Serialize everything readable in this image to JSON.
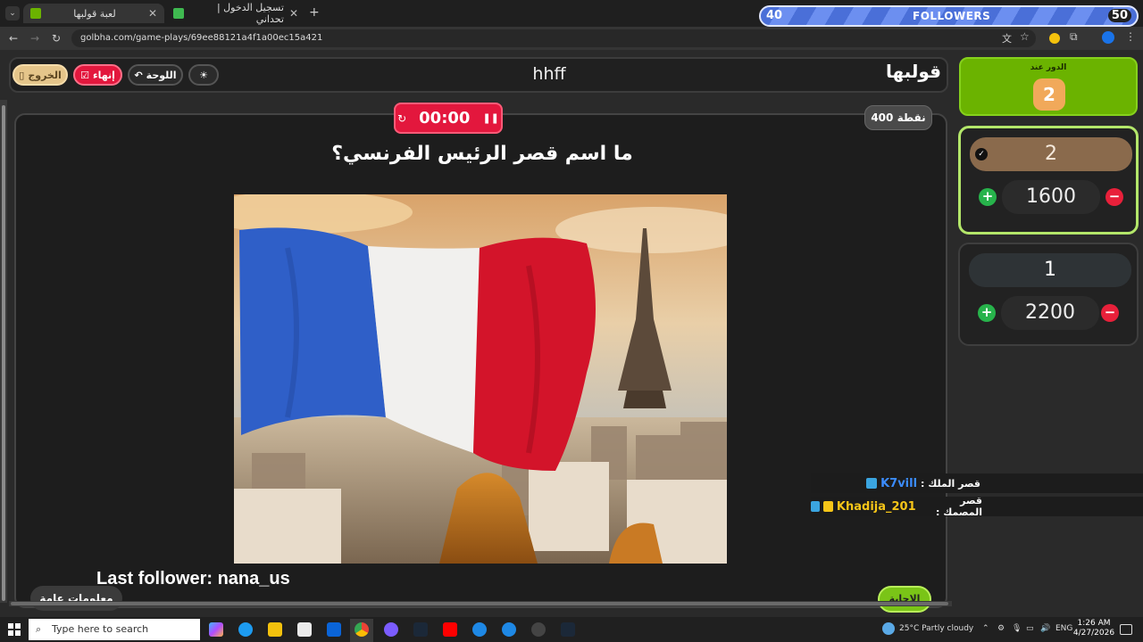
{
  "browser": {
    "tabs": [
      {
        "title": "لعبة قولبها"
      },
      {
        "title": "تسجيل الدخول | تحداني"
      }
    ],
    "url": "golbha.com/game-plays/69ee88121a4f1a00ec15a421"
  },
  "overlay": {
    "followers_count": "40",
    "followers_label": "FOLLOWERS",
    "followers_goal": "50"
  },
  "header": {
    "logo": "قولبها",
    "board_title": "hhff",
    "exit_label": "الخروج",
    "end_label": "إنهاء",
    "board_label": "اللوحة"
  },
  "game": {
    "timer": "00:00",
    "points": "400 نقطة",
    "question": "ما اسم قصر الرئيس الفرنسي؟",
    "answer_label": "الإجابة",
    "info_label": "معلومات عامة"
  },
  "turn": {
    "label": "الدور عند",
    "team": "2"
  },
  "teams": [
    {
      "name": "2",
      "score": "1600"
    },
    {
      "name": "1",
      "score": "2200"
    }
  ],
  "chat": [
    {
      "user": "K7vill",
      "message": "قصر الملك :"
    },
    {
      "user": "Khadija_201",
      "message": "قصر المصمك :"
    }
  ],
  "stream": {
    "last_follower": "Last follower: nana_us"
  },
  "taskbar": {
    "search_placeholder": "Type here to search",
    "weather": "25°C  Partly cloudy",
    "lang": "ENG",
    "time": "1:26 AM",
    "date": "4/27/2026"
  },
  "colors": {
    "accent_red": "#e3173d",
    "accent_green": "#6bb300",
    "team2_name_bg": "#8a6a4c",
    "team1_name_bg": "#2e3336"
  }
}
